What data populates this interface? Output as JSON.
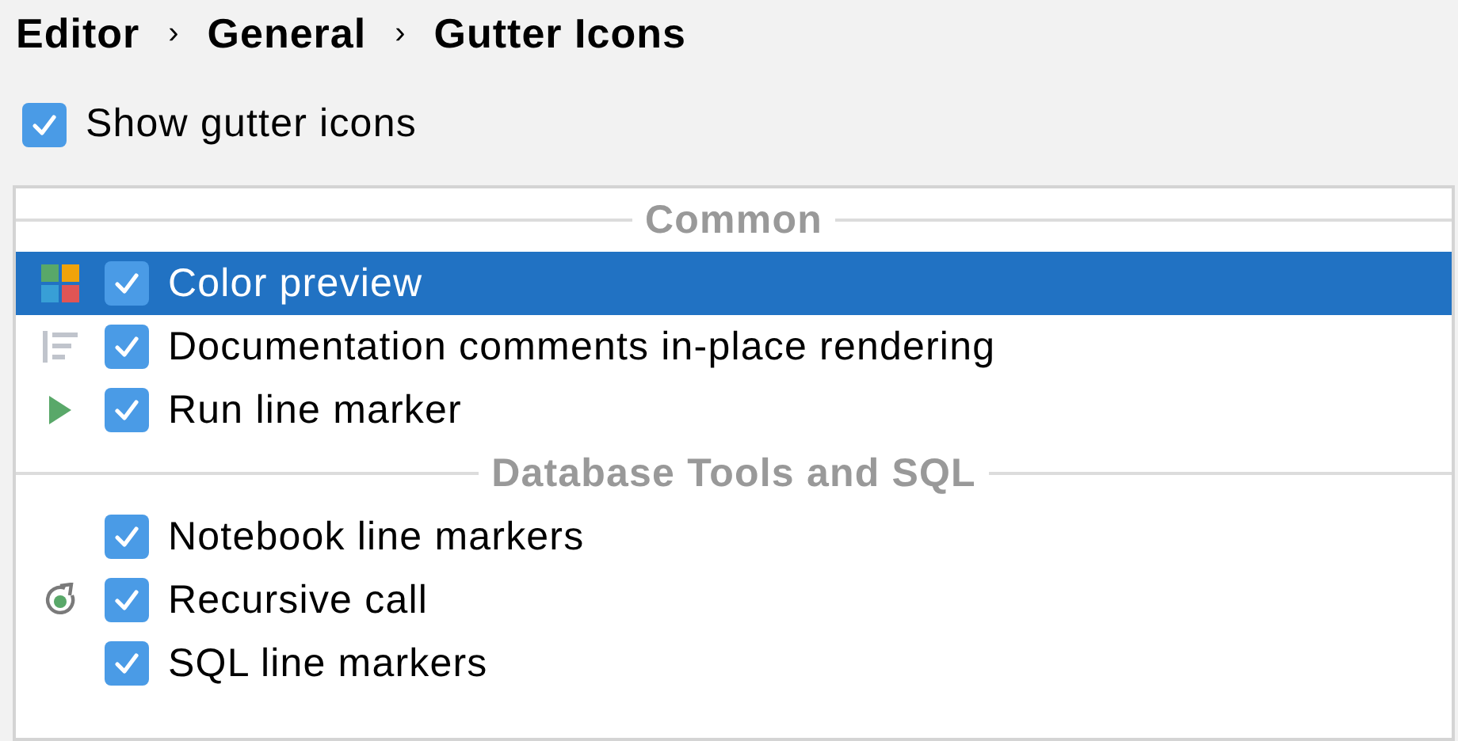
{
  "breadcrumb": [
    "Editor",
    "General",
    "Gutter Icons"
  ],
  "breadcrumb_separator": "›",
  "show_gutter_icons": {
    "label": "Show gutter icons",
    "checked": true
  },
  "groups": [
    {
      "title": "Common",
      "items": [
        {
          "label": "Color preview",
          "checked": true,
          "selected": true,
          "kind": "color-grid"
        },
        {
          "label": "Documentation comments in-place rendering",
          "checked": true,
          "selected": false,
          "kind": "doc-lines"
        },
        {
          "label": "Run line marker",
          "checked": true,
          "selected": false,
          "kind": "run"
        }
      ]
    },
    {
      "title": "Database Tools and SQL",
      "items": [
        {
          "label": "Notebook line markers",
          "checked": true,
          "selected": false,
          "kind": "plain"
        },
        {
          "label": "Recursive call",
          "checked": true,
          "selected": false,
          "kind": "recursive"
        },
        {
          "label": "SQL line markers",
          "checked": true,
          "selected": false,
          "kind": "plain"
        }
      ]
    }
  ]
}
